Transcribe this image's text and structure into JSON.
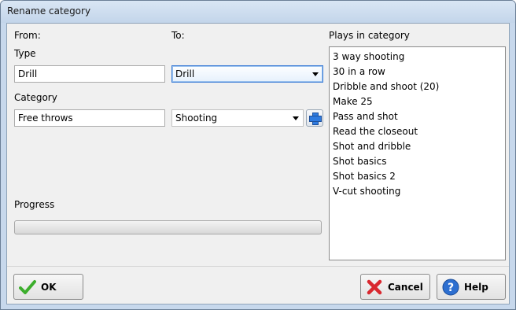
{
  "window": {
    "title": "Rename category"
  },
  "labels": {
    "from": "From:",
    "to": "To:",
    "type": "Type",
    "category": "Category",
    "progress": "Progress",
    "plays_in_category": "Plays in category"
  },
  "from": {
    "type_value": "Drill",
    "category_value": "Free throws"
  },
  "to": {
    "type_selected": "Drill",
    "category_selected": "Shooting"
  },
  "plays": [
    "3 way shooting",
    "30 in a row",
    "Dribble and shoot (20)",
    "Make 25",
    "Pass and shot",
    "Read the closeout",
    "Shot and dribble",
    "Shot basics",
    "Shot basics 2",
    "V-cut shooting"
  ],
  "progress": {
    "fraction": 0
  },
  "buttons": {
    "ok": "OK",
    "cancel": "Cancel",
    "help": "Help"
  },
  "icons": {
    "ok": "checkmark-icon",
    "cancel": "x-icon",
    "help": "question-icon",
    "add": "plus-icon",
    "dropdown": "chevron-down-icon"
  },
  "colors": {
    "check_green": "#3cae2c",
    "cancel_red": "#d9282f",
    "help_blue": "#2d6fd0",
    "focus_blue": "#3a7bd5"
  }
}
